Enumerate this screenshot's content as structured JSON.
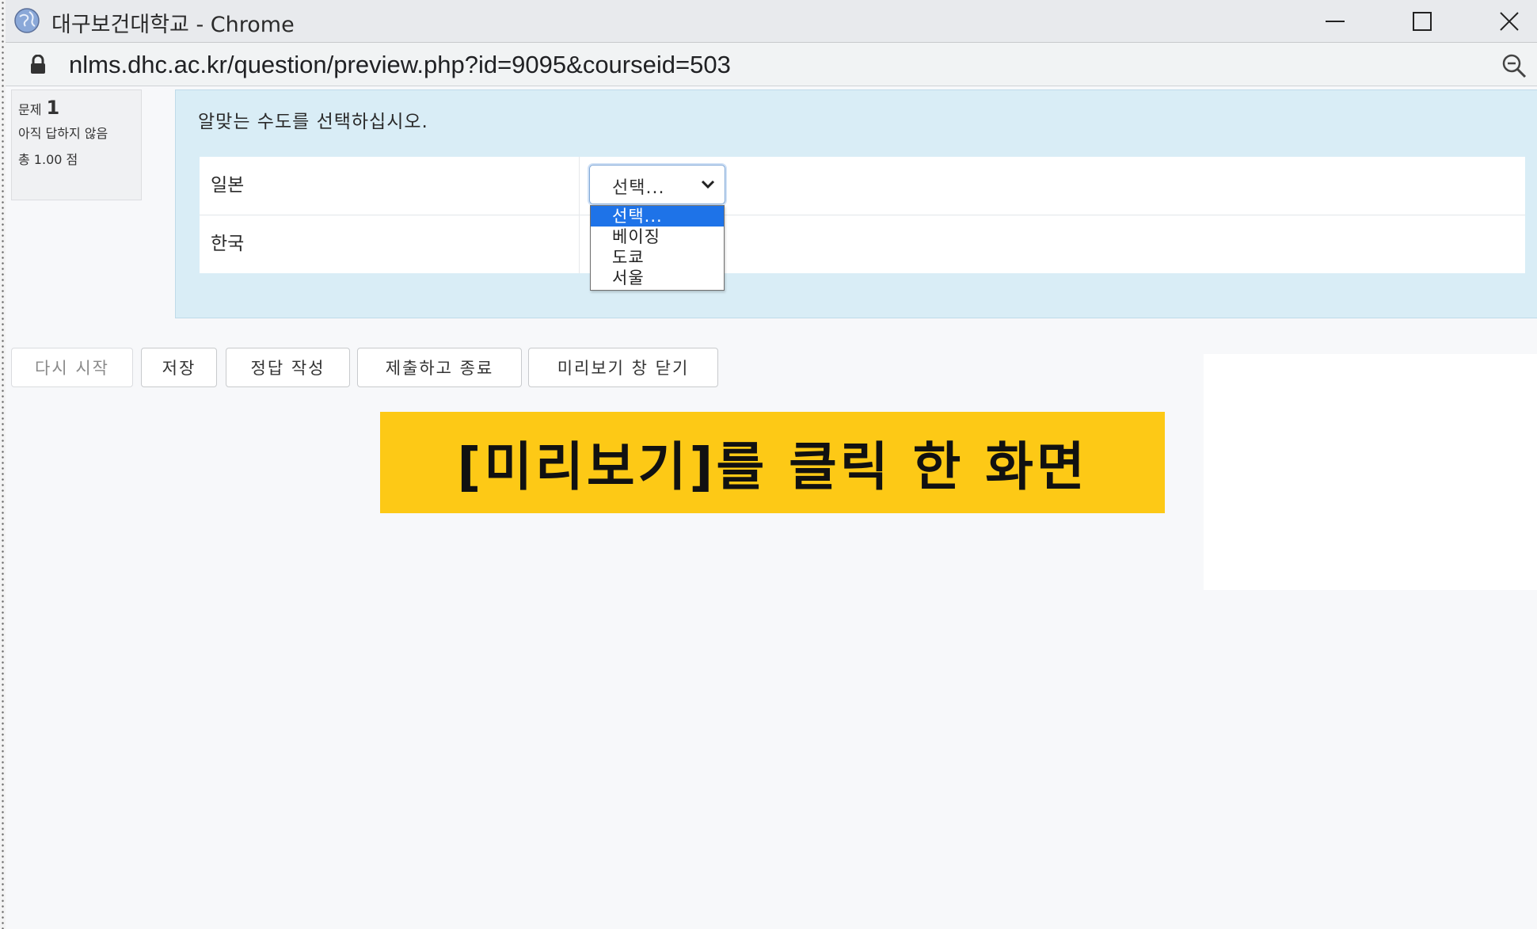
{
  "window": {
    "title": "대구보건대학교 - Chrome",
    "url": "nlms.dhc.ac.kr/question/preview.php?id=9095&courseid=503",
    "icons": [
      "globe-icon",
      "minimize-icon",
      "maximize-icon",
      "close-icon",
      "lock-icon",
      "zoom-icon"
    ]
  },
  "question_info": {
    "label": "문제",
    "number": "1",
    "state": "아직 답하지 않음",
    "grade": "총 1.00 점"
  },
  "question": {
    "prompt": "알맞는 수도를 선택하십시오.",
    "rows": [
      {
        "label": "일본",
        "selected": "선택..."
      },
      {
        "label": "한국",
        "selected": "선택..."
      }
    ],
    "dropdown_options": [
      "선택...",
      "베이징",
      "도쿄",
      "서울"
    ],
    "highlighted_option": "선택..."
  },
  "buttons": {
    "restart": "다시 시작",
    "save": "저장",
    "fill_correct": "정답 작성",
    "submit_finish": "제출하고 종료",
    "close_preview": "미리보기 창 닫기"
  },
  "banner": {
    "text": "[미리보기]를 클릭 한 화면",
    "color": "#fdc916"
  },
  "colors": {
    "content_bg": "#d9edf6",
    "highlight": "#1e73e8"
  }
}
